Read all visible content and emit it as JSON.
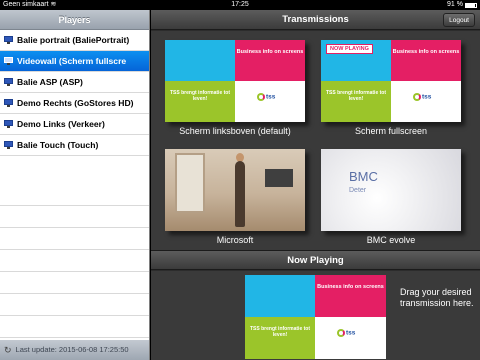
{
  "status_bar": {
    "carrier": "Geen simkaart",
    "wifi_icon": "wifi-icon",
    "time": "17:25",
    "battery_text": "91 %",
    "battery_level": 0.91
  },
  "players_panel": {
    "title": "Players",
    "items": [
      {
        "label": "Balie portrait (BaliePortrait)",
        "selected": false
      },
      {
        "label": "Videowall (Scherm fullscre",
        "selected": true
      },
      {
        "label": "Balie ASP (ASP)",
        "selected": false
      },
      {
        "label": "Demo Rechts (GoStores HD)",
        "selected": false
      },
      {
        "label": "Demo Links (Verkeer)",
        "selected": false
      },
      {
        "label": "Balie Touch (Touch)",
        "selected": false
      }
    ],
    "footer": "Last update: 2015-06-08 17:25:50"
  },
  "transmissions_panel": {
    "title": "Transmissions",
    "logout_label": "Logout",
    "tiles": [
      {
        "caption": "Scherm linksboven (default)"
      },
      {
        "caption": "Scherm fullscreen",
        "tag": "NOW PLAYING"
      },
      {
        "caption": "Microsoft"
      },
      {
        "caption": "BMC evolve"
      }
    ],
    "page_count": 2,
    "current_page": 1
  },
  "slide_content": {
    "pink_text": "Business info on screens",
    "green_text": "TSS brengt informatie tot leven!",
    "logo_text": "tss",
    "bmc_text": "BMC",
    "bmc_sub": "Deter"
  },
  "now_playing": {
    "title": "Now Playing",
    "hint": "Drag your desired transmission here."
  },
  "colors": {
    "cyan": "#21b6e6",
    "pink": "#e41f64",
    "green": "#9bc52a",
    "selection_blue": "#0a7fe6"
  }
}
